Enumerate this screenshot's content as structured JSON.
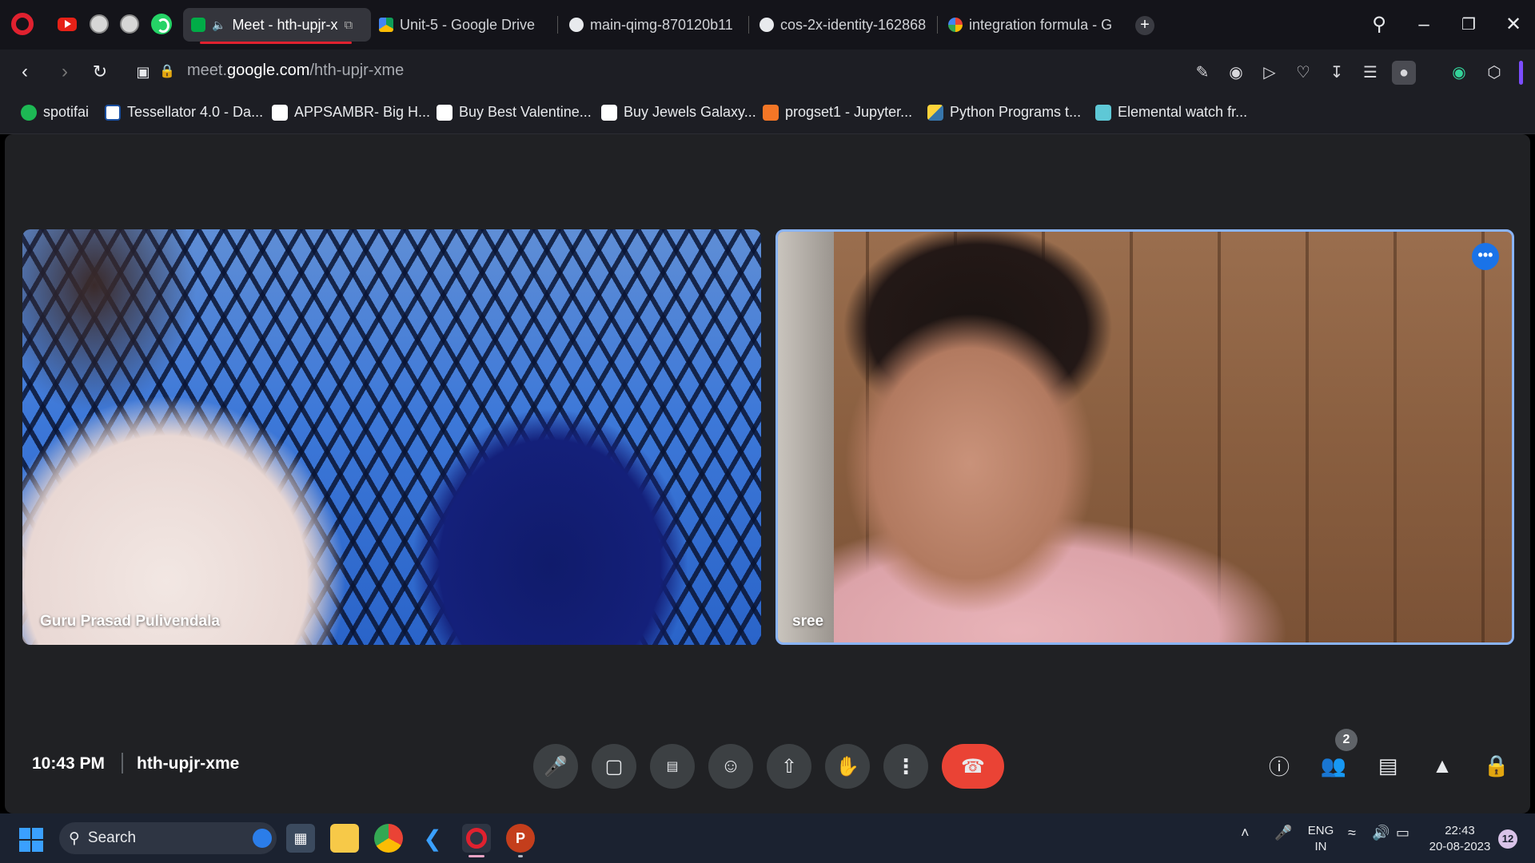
{
  "browser": {
    "tabs": [
      {
        "title": "Meet - hth-upjr-x",
        "active": true
      },
      {
        "title": "Unit-5 - Google Drive",
        "active": false
      },
      {
        "title": "main-qimg-870120b11",
        "active": false
      },
      {
        "title": "cos-2x-identity-162868",
        "active": false
      },
      {
        "title": "integration formula - G",
        "active": false
      }
    ],
    "address": {
      "domain_prefix": "meet.",
      "domain": "google.com",
      "path": "/hth-upjr-xme"
    },
    "bookmarks": [
      {
        "label": "spotifai",
        "icon": "spotify-icon"
      },
      {
        "label": "Tessellator 4.0 - Da...",
        "icon": "tessellator-icon"
      },
      {
        "label": "APPSAMBR- Big H...",
        "icon": "amazon-icon"
      },
      {
        "label": "Buy Best Valentine...",
        "icon": "amazon-icon"
      },
      {
        "label": "Buy Jewels Galaxy...",
        "icon": "amazon-icon"
      },
      {
        "label": "progset1 - Jupyter...",
        "icon": "jupyter-icon"
      },
      {
        "label": "Python Programs t...",
        "icon": "python-icon"
      },
      {
        "label": "Elemental watch fr...",
        "icon": "shopify-icon"
      }
    ]
  },
  "meet": {
    "participants": [
      {
        "name": "Guru Prasad Pulivendala"
      },
      {
        "name": "sree"
      }
    ],
    "time": "10:43 PM",
    "code": "hth-upjr-xme",
    "people_count": "2",
    "more_options_glyph": "•••"
  },
  "taskbar": {
    "search_label": "Search",
    "lang_line1": "ENG",
    "lang_line2": "IN",
    "clock_time": "22:43",
    "clock_date": "20-08-2023",
    "notification_count": "12"
  },
  "colors": {
    "accent": "#8ab4f8",
    "end_call": "#ea4335",
    "opera_red": "#e0212f"
  }
}
